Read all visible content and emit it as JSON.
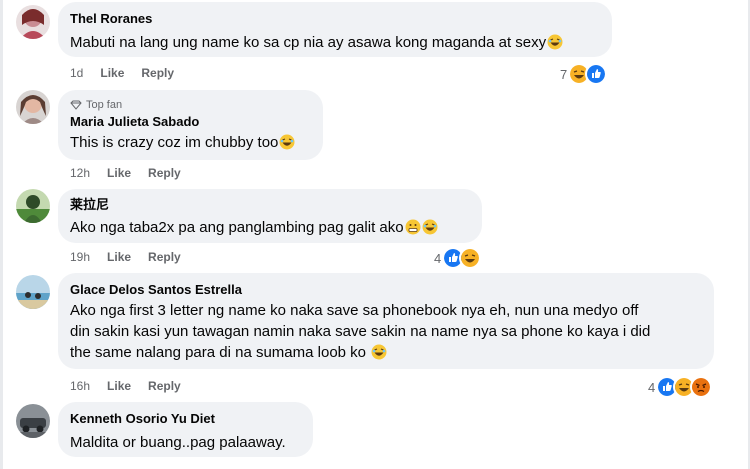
{
  "comments": [
    {
      "author": "Thel Roranes",
      "badge": "",
      "lines": [
        "Mabuti na lang ung name ko sa cp nia ay asawa kong maganda at sexy"
      ],
      "time": "1d",
      "like": "Like",
      "reply": "Reply",
      "reaction_count": "7",
      "reactions": [
        "haha-icon",
        "like-icon"
      ]
    },
    {
      "author": "Maria Julieta Sabado",
      "badge": "Top fan",
      "lines": [
        "This is crazy coz im chubby too"
      ],
      "time": "12h",
      "like": "Like",
      "reply": "Reply",
      "reaction_count": "",
      "reactions": []
    },
    {
      "author": "莱拉尼",
      "badge": "",
      "lines": [
        "Ako nga taba2x pa ang panglambing pag galit ako"
      ],
      "time": "19h",
      "like": "Like",
      "reply": "Reply",
      "reaction_count": "4",
      "reactions": [
        "like-icon",
        "haha-icon"
      ]
    },
    {
      "author": "Glace Delos Santos Estrella",
      "badge": "",
      "lines": [
        "Ako nga first 3 letter ng name ko naka save sa phonebook nya eh, nun una medyo off",
        "din sakin kasi yun tawagan namin naka save sakin na name nya sa phone ko kaya i did",
        "the same nalang para di na sumama loob ko"
      ],
      "time": "16h",
      "like": "Like",
      "reply": "Reply",
      "reaction_count": "4",
      "reactions": [
        "like-icon",
        "haha-icon",
        "angry-icon"
      ]
    },
    {
      "author": "Kenneth Osorio Yu Diet",
      "badge": "",
      "lines": [
        "Maldita or buang..pag palaaway."
      ],
      "time": "",
      "like": "",
      "reply": "",
      "reaction_count": "",
      "reactions": []
    }
  ],
  "colors": {
    "bubble": "#f0f2f5",
    "like": "#1877f2",
    "haha": "#f7b125",
    "angry": "#e9710f",
    "meta": "#65676b"
  }
}
